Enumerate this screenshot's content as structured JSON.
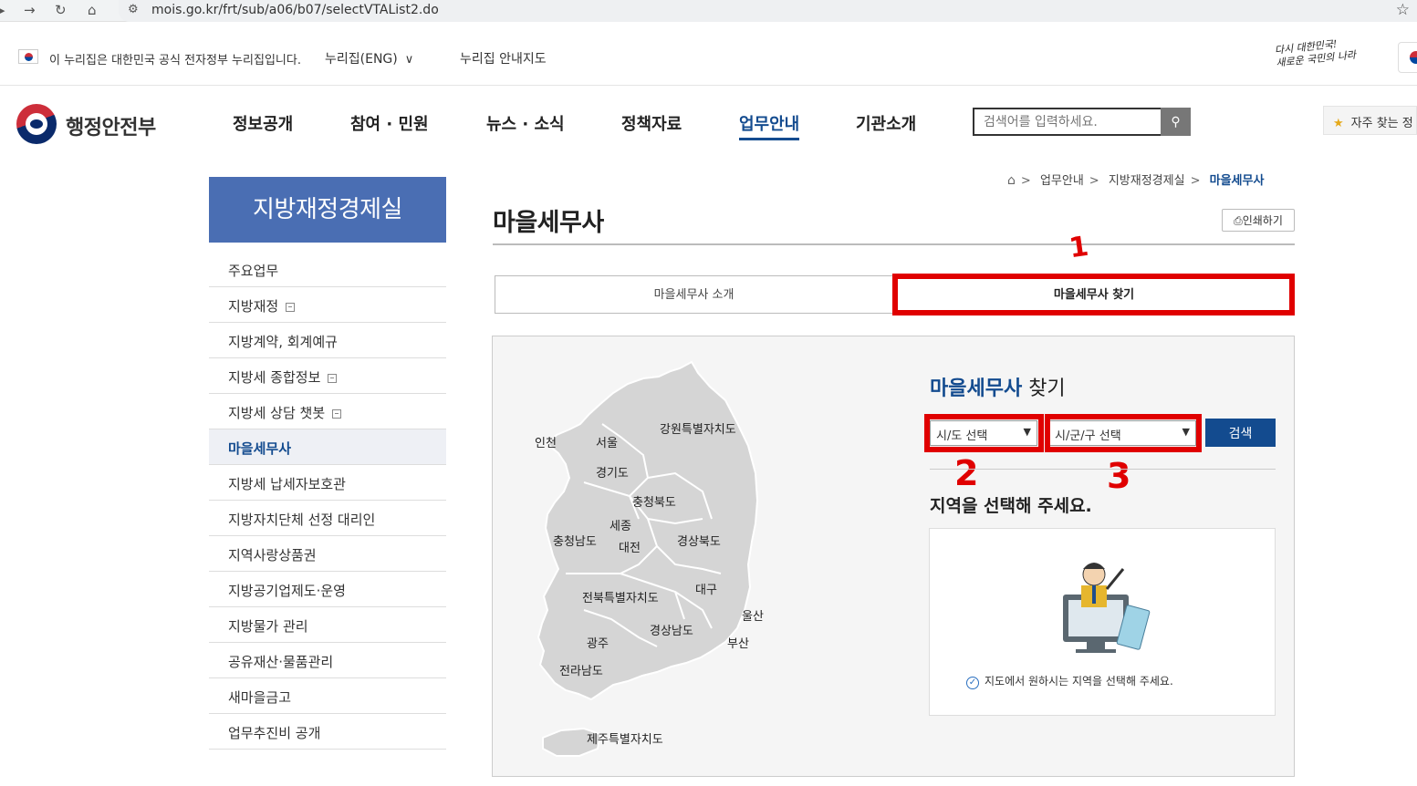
{
  "browser": {
    "url": "mois.go.kr/frt/sub/a06/b07/selectVTAList2.do",
    "nav_icons": [
      "back-icon",
      "forward-icon",
      "reload-icon",
      "home-icon"
    ]
  },
  "gov_strip": {
    "notice": "이 누리집은 대한민국 공식 전자정부 누리집입니다.",
    "nuri_eng": "누리집(ENG)",
    "nuri_guide": "누리집 안내지도",
    "slogan_line1": "다시 대한민국!",
    "slogan_line2": "새로운 국민의 나라"
  },
  "header": {
    "logo_text": "행정안전부",
    "menu": [
      {
        "label": "정보공개"
      },
      {
        "label": "참여 · 민원"
      },
      {
        "label": "뉴스 · 소식"
      },
      {
        "label": "정책자료"
      },
      {
        "label": "업무안내",
        "active": true
      },
      {
        "label": "기관소개"
      }
    ],
    "search_placeholder": "검색어를 입력하세요.",
    "favorites": "자주 찾는 정"
  },
  "sidebar": {
    "title": "지방재정경제실",
    "items": [
      {
        "label": "주요업무"
      },
      {
        "label": "지방재정",
        "expand": true
      },
      {
        "label": "지방계약, 회계예규"
      },
      {
        "label": "지방세 종합정보",
        "expand": true
      },
      {
        "label": "지방세 상담 챗봇",
        "expand": true
      },
      {
        "label": "마을세무사",
        "active": true
      },
      {
        "label": "지방세 납세자보호관"
      },
      {
        "label": "지방자치단체 선정 대리인"
      },
      {
        "label": "지역사랑상품권"
      },
      {
        "label": "지방공기업제도·운영"
      },
      {
        "label": "지방물가 관리"
      },
      {
        "label": "공유재산·물품관리"
      },
      {
        "label": "새마을금고"
      },
      {
        "label": "업무추진비 공개"
      }
    ]
  },
  "breadcrumb": {
    "items": [
      "업무안내",
      "지방재정경제실",
      "마을세무사"
    ]
  },
  "page": {
    "title": "마을세무사",
    "print_label": "인쇄하기",
    "tabs": [
      {
        "label": "마을세무사 소개"
      },
      {
        "label": "마을세무사 찾기",
        "active": true
      }
    ]
  },
  "map": {
    "regions": [
      "인천",
      "서울",
      "강원특별자치도",
      "경기도",
      "충청북도",
      "세종",
      "충청남도",
      "대전",
      "경상북도",
      "대구",
      "전북특별자치도",
      "울산",
      "광주",
      "경상남도",
      "부산",
      "전라남도",
      "제주특별자치도"
    ]
  },
  "finder": {
    "title_blue": "마을세무사",
    "title_rest": " 찾기",
    "sido_select": "시/도 선택",
    "sigungu_select": "시/군/구 선택",
    "search_button": "검색",
    "prompt": "지역을 선택해 주세요.",
    "note": "지도에서 원하시는 지역을 선택해 주세요."
  },
  "annotations": [
    "1",
    "2",
    "3"
  ],
  "colors": {
    "primary": "#134b8f",
    "sidebar_title_bg": "#4a6eb3",
    "annotation_red": "#e00000"
  }
}
